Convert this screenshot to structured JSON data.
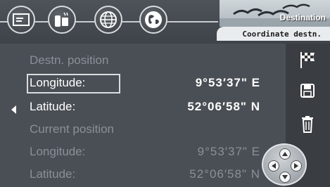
{
  "header": {
    "title": "Destination",
    "subtitle": "Coordinate destn."
  },
  "toolbar": {
    "buttons": [
      {
        "name": "message-icon"
      },
      {
        "name": "phone-icon"
      },
      {
        "name": "globe-icon"
      },
      {
        "name": "navigation-globe-icon"
      }
    ]
  },
  "destination": {
    "section_label": "Destn. position",
    "longitude_label": "Longitude:",
    "longitude_value": "9°53′37\" E",
    "latitude_label": "Latitude:",
    "latitude_value": "52°06′58\" N"
  },
  "current": {
    "section_label": "Current position",
    "longitude_label": "Longitude:",
    "longitude_value": "9°53′37\" E",
    "latitude_label": "Latitude:",
    "latitude_value": "52°06′58\" N"
  },
  "sidebar": {
    "items": [
      {
        "name": "checkered-flag-icon"
      },
      {
        "name": "save-icon"
      },
      {
        "name": "delete-icon"
      }
    ]
  },
  "colors": {
    "background": "#4a4f55",
    "text_active": "#ffffff",
    "text_dim": "#8a9097"
  }
}
